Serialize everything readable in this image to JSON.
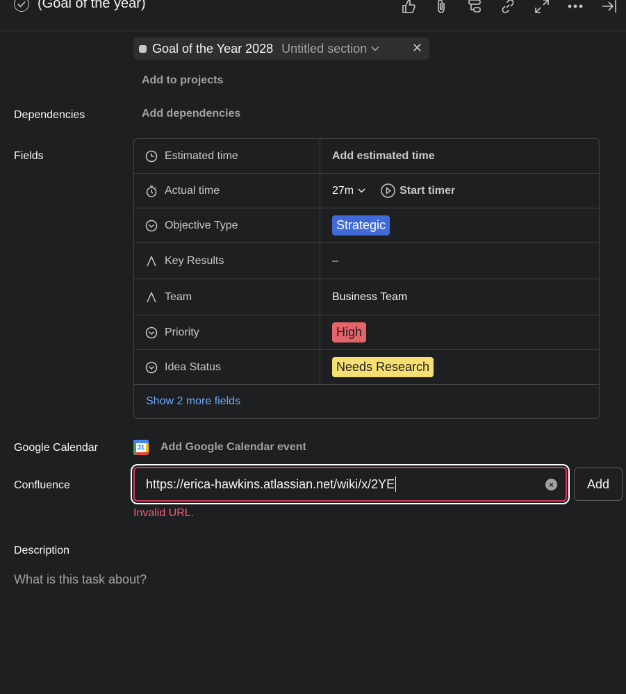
{
  "header": {
    "title": "(Goal of the year)",
    "toolbar_icons": [
      "like-icon",
      "attachment-icon",
      "subtask-icon",
      "link-icon",
      "expand-icon",
      "more-icon",
      "close-panel-icon"
    ]
  },
  "projects": {
    "chip": {
      "project": "Goal of the Year 2028",
      "section": "Untitled section"
    },
    "add_label": "Add to projects"
  },
  "dependencies": {
    "label": "Dependencies",
    "add_label": "Add dependencies"
  },
  "fields": {
    "label": "Fields",
    "rows": [
      {
        "name": "Estimated time",
        "icon": "clock-icon",
        "value": "Add estimated time"
      },
      {
        "name": "Actual time",
        "icon": "stopwatch-icon",
        "value": "27m",
        "action": "Start timer"
      },
      {
        "name": "Objective Type",
        "icon": "dropdown-field-icon",
        "value": "Strategic",
        "color": "#3f6ad8"
      },
      {
        "name": "Key Results",
        "icon": "text-field-icon",
        "value": "–"
      },
      {
        "name": "Team",
        "icon": "text-field-icon",
        "value": "Business Team"
      },
      {
        "name": "Priority",
        "icon": "dropdown-field-icon",
        "value": "High",
        "color": "#e56469"
      },
      {
        "name": "Idea Status",
        "icon": "dropdown-field-icon",
        "value": "Needs Research",
        "color": "#f8df72"
      }
    ],
    "show_more": "Show 2 more fields"
  },
  "google_calendar": {
    "label": "Google Calendar",
    "icon_day": "31",
    "add_label": "Add Google Calendar event"
  },
  "confluence": {
    "label": "Confluence",
    "value": "https://erica-hawkins.atlassian.net/wiki/x/2YE",
    "add_button": "Add",
    "error": "Invalid URL."
  },
  "description": {
    "label": "Description",
    "placeholder": "What is this task about?"
  }
}
